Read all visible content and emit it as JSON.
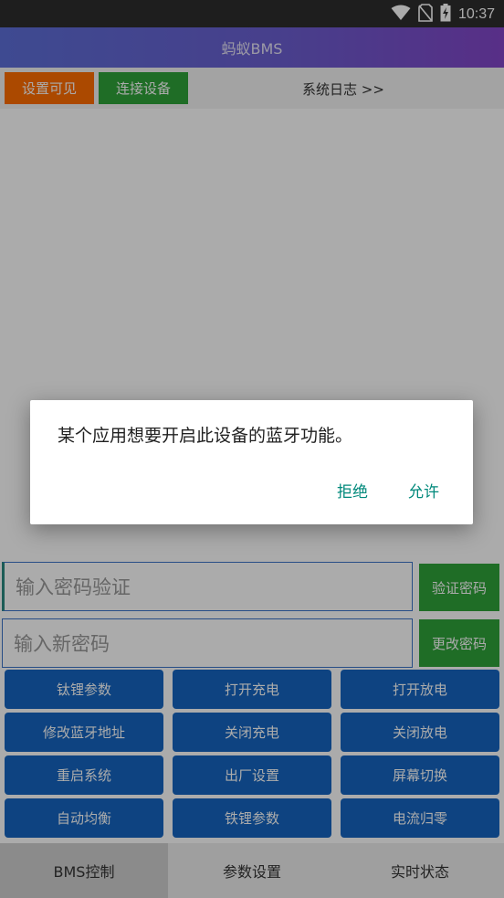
{
  "status_bar": {
    "time": "10:37",
    "icons": [
      "wifi-icon",
      "no-sim-icon",
      "battery-charging-icon"
    ]
  },
  "app": {
    "title": "蚂蚁BMS"
  },
  "toolbar": {
    "set_visible_label": "设置可见",
    "connect_label": "连接设备",
    "log_link": "系统日志 >>"
  },
  "password": {
    "verify_placeholder": "输入密码验证",
    "verify_button": "验证密码",
    "new_placeholder": "输入新密码",
    "change_button": "更改密码"
  },
  "controls": [
    "钛锂参数",
    "打开充电",
    "打开放电",
    "修改蓝牙地址",
    "关闭充电",
    "关闭放电",
    "重启系统",
    "出厂设置",
    "屏幕切换",
    "自动均衡",
    "铁锂参数",
    "电流归零"
  ],
  "bottom_nav": {
    "tabs": [
      "BMS控制",
      "参数设置",
      "实时状态"
    ],
    "active": 0
  },
  "dialog": {
    "message": "某个应用想要开启此设备的蓝牙功能。",
    "deny": "拒绝",
    "allow": "允许"
  },
  "colors": {
    "accent_orange": "#ff6d00",
    "accent_green": "#2fa33a",
    "control_blue": "#1565c0",
    "dialog_action": "#00897b"
  }
}
